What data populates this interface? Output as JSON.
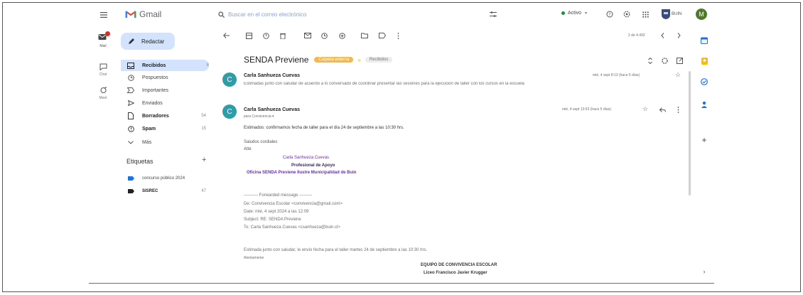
{
  "app": {
    "name": "Gmail"
  },
  "header": {
    "search_placeholder": "Buscar en el correo electrónico",
    "status": "Activo",
    "org_label": "BUIN",
    "avatar_letter": "M"
  },
  "leftrail": {
    "mail": "Mail",
    "chat": "Chat",
    "meet": "Meet"
  },
  "compose": {
    "label": "Redactar"
  },
  "nav": [
    {
      "label": "Recibidos",
      "count": "8",
      "icon": "inbox-icon",
      "bold": true
    },
    {
      "label": "Pospuestos",
      "count": "",
      "icon": "clock-icon",
      "bold": false
    },
    {
      "label": "Importantes",
      "count": "",
      "icon": "important-icon",
      "bold": false
    },
    {
      "label": "Enviados",
      "count": "",
      "icon": "send-icon",
      "bold": false
    },
    {
      "label": "Borradores",
      "count": "54",
      "icon": "draft-icon",
      "bold": true
    },
    {
      "label": "Spam",
      "count": "15",
      "icon": "spam-icon",
      "bold": true
    },
    {
      "label": "Más",
      "count": "",
      "icon": "chevron-down-icon",
      "bold": false
    }
  ],
  "labels": {
    "title": "Etiquetas",
    "items": [
      {
        "label": "concurso público 2024",
        "count": "",
        "color": "#1a73e8"
      },
      {
        "label": "SISREC",
        "count": "47",
        "color": "#202124"
      }
    ]
  },
  "toolbar": {
    "pagination": "2 de 4.492"
  },
  "thread": {
    "subject": "SENDA Previene",
    "chip_label": "Carpeta externa",
    "chip_inbox": "Recibidos",
    "messages": [
      {
        "sender": "Carla Sanhueza Cuevas",
        "date": "mié, 4 sept 8:13 (hace 5 días)",
        "snippet": "Estimadas junto con saludar de acuerdo a lo conversado de coordinar presentar las sesiones para la ejecución de taller con los cursos en la escuela"
      },
      {
        "sender": "Carla Sanhueza Cuevas",
        "to": "para Convivencia ▾",
        "date": "mié, 4 sept 13:53 (hace 5 días)",
        "greeting": "Estimados: confirmamos fecha de taller para el día 24 de septiembre a las 10:30 hrs.",
        "closing": "Saludos cordiales",
        "signoff": "Atte",
        "sig_name": "Carla Sanhueza Cuevas",
        "sig_role": "Profesional de Apoyo",
        "sig_org": "Oficina SENDA Previene Ilustre Municipalidad de Buin",
        "fwd_header": "---------- Forwarded message ---------",
        "fwd_from": "De: Convivencia Escolar <convivencia@gmail.com>",
        "fwd_date": "Date: mié, 4 sept 2024 a las 12:09",
        "fwd_subject": "Subject: RE: SENDA Previene",
        "fwd_to": "To: Carla Sanhueza Cuevas <csanhueza@buin.cl>",
        "fwd_body": "Estimada junto con saludar, le envío fecha para el taller martes 24 de septiembre a las 10:30 hrs.",
        "fwd_signoff": "Atentamente",
        "team": "EQUIPO DE CONVIVENCIA ESCOLAR",
        "school": "Liceo Francisco Javier Krugger"
      }
    ]
  }
}
